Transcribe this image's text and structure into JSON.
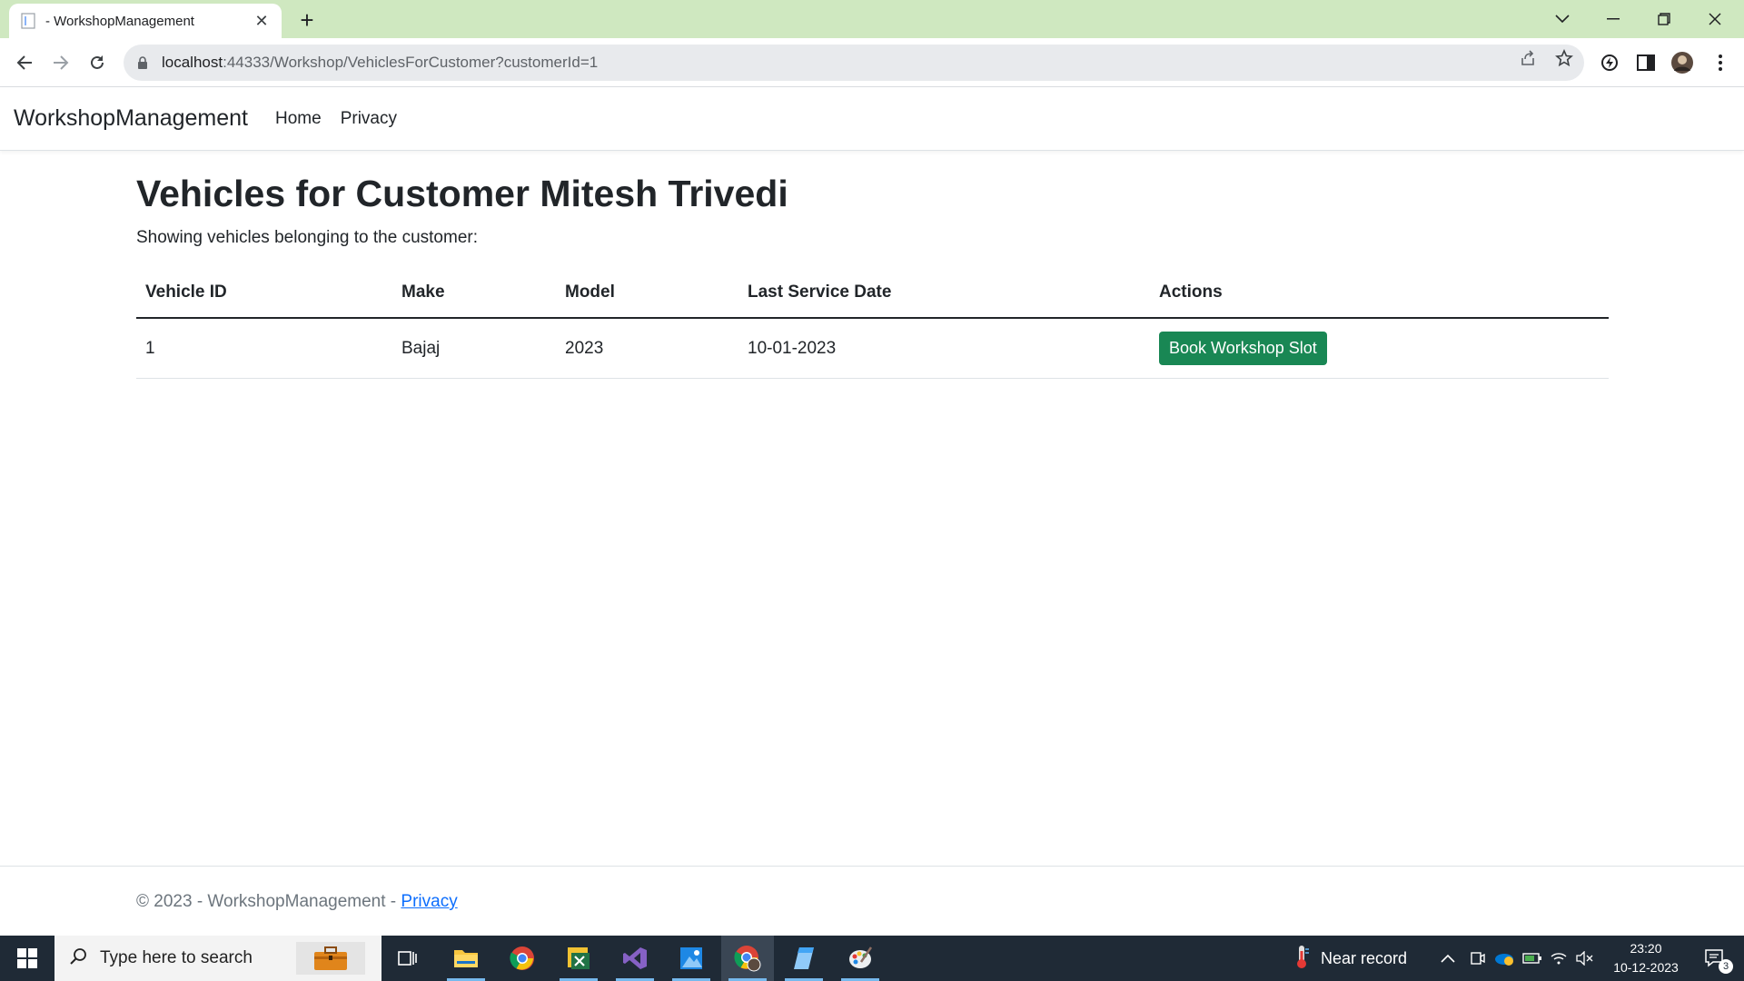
{
  "browser": {
    "tab_title": "- WorkshopManagement",
    "url_host": "localhost",
    "url_rest": ":44333/Workshop/VehiclesForCustomer?customerId=1"
  },
  "site": {
    "brand": "WorkshopManagement",
    "nav": {
      "home": "Home",
      "privacy": "Privacy"
    }
  },
  "page": {
    "title": "Vehicles for Customer Mitesh Trivedi",
    "subtitle": "Showing vehicles belonging to the customer:",
    "table": {
      "headers": [
        "Vehicle ID",
        "Make",
        "Model",
        "Last Service Date",
        "Actions"
      ],
      "rows": [
        {
          "id": "1",
          "make": "Bajaj",
          "model": "2023",
          "last_service": "10-01-2023",
          "action": "Book Workshop Slot"
        }
      ]
    }
  },
  "footer": {
    "text": "© 2023 - WorkshopManagement - ",
    "link": "Privacy"
  },
  "taskbar": {
    "search_placeholder": "Type here to search",
    "weather": "Near record",
    "time": "23:20",
    "date": "10-12-2023",
    "notification_count": "3"
  },
  "colors": {
    "tabstrip": "#cfe8c0",
    "success": "#198754",
    "taskbar": "#1f2a36"
  }
}
